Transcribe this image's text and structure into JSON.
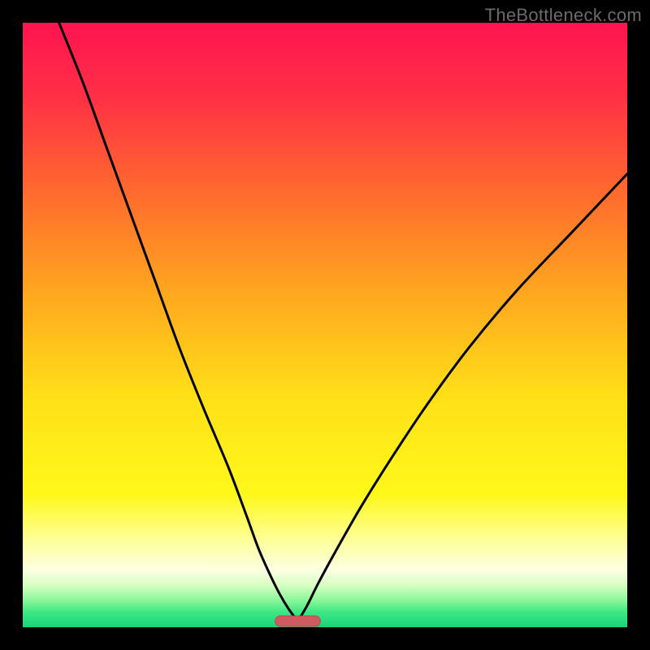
{
  "watermark": "TheBottleneck.com",
  "colors": {
    "frame": "#000000",
    "curve": "#000000",
    "marker_fill": "#cf5a5f",
    "marker_stroke": "#b84a4f",
    "gradient_stops": [
      {
        "offset": 0.0,
        "color": "#ff1450"
      },
      {
        "offset": 0.12,
        "color": "#ff2f45"
      },
      {
        "offset": 0.28,
        "color": "#ff6a2e"
      },
      {
        "offset": 0.45,
        "color": "#ffa81f"
      },
      {
        "offset": 0.62,
        "color": "#ffe018"
      },
      {
        "offset": 0.78,
        "color": "#fff81a"
      },
      {
        "offset": 0.86,
        "color": "#fdffa0"
      },
      {
        "offset": 0.905,
        "color": "#fcffe0"
      },
      {
        "offset": 0.93,
        "color": "#d8ffc4"
      },
      {
        "offset": 0.955,
        "color": "#8cf79a"
      },
      {
        "offset": 0.975,
        "color": "#3ee684"
      },
      {
        "offset": 1.0,
        "color": "#18d47a"
      }
    ]
  },
  "chart_data": {
    "type": "line",
    "title": "",
    "xlabel": "",
    "ylabel": "",
    "xlim": [
      0,
      100
    ],
    "ylim": [
      0,
      100
    ],
    "grid": false,
    "legend": false,
    "marker": {
      "x_center": 45.5,
      "width": 7.5,
      "y": 1.0
    },
    "series": [
      {
        "name": "left-curve",
        "x": [
          6,
          10,
          14,
          18,
          22,
          26,
          30,
          34,
          37,
          39,
          41,
          42.5,
          44,
          45.5
        ],
        "y": [
          100,
          90,
          79,
          68,
          57,
          46,
          36,
          26.5,
          18.5,
          13,
          8.5,
          5.5,
          3,
          1
        ]
      },
      {
        "name": "right-curve",
        "x": [
          45.5,
          47,
          49,
          52,
          56,
          61,
          67,
          74,
          82,
          91,
          100
        ],
        "y": [
          1,
          3.5,
          7.5,
          13,
          20,
          28,
          37,
          46.5,
          56,
          65.5,
          75
        ]
      }
    ]
  }
}
